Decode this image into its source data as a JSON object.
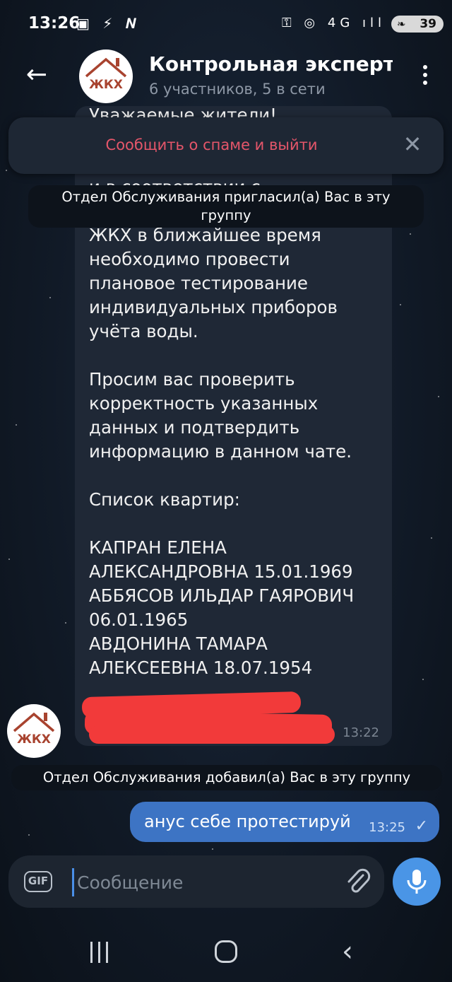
{
  "status_bar": {
    "time": "13:26",
    "left_icons": "▣ ⚡ 𝑵",
    "right_icons": "⚿ ◎ 4G ıll",
    "battery": "39"
  },
  "header": {
    "avatar_text": "ЖКХ",
    "title": "Контрольная эксперти",
    "subtitle": "6 участников, 5 в сети"
  },
  "spam_bar": {
    "label": "Сообщить о спаме и выйти"
  },
  "service_messages": {
    "invited": "Отдел Обслуживания пригласил(а) Вас в эту группу",
    "added": "Отдел Обслуживания добавил(а) Вас в эту группу"
  },
  "incoming_message": {
    "text": "Уважаемые жители!\n\nООО \"Доступный сервис\"\nи в соответствии с\nпериодической инспекцией\nЖКХ в ближайшее время\nнеобходимо провести\nплановое тестирование\nиндивидуальных приборов\nучёта воды.\n\nПросим вас проверить\nкорректность указанных\nданных и подтвердить\nинформацию в данном чате.\n\nСписок квартир:\n\nКАПРАН ЕЛЕНА\nАЛЕКСАНДРОВНА 15.01.1969\nАББЯСОВ ИЛЬДАР ГАЯРОВИЧ\n06.01.1965\nАВДОНИНА ТАМАРА\nАЛЕКСЕЕВНА 18.07.1954",
    "time": "13:22"
  },
  "outgoing_message": {
    "text": "анус себе протестируй",
    "time": "13:25"
  },
  "composer": {
    "gif_label": "GIF",
    "placeholder": "Сообщение"
  },
  "colors": {
    "accent": "#4a95e6",
    "spam": "#e5566a",
    "outgoing_bubble": "#3d74c4",
    "redaction": "#f23a3a"
  }
}
